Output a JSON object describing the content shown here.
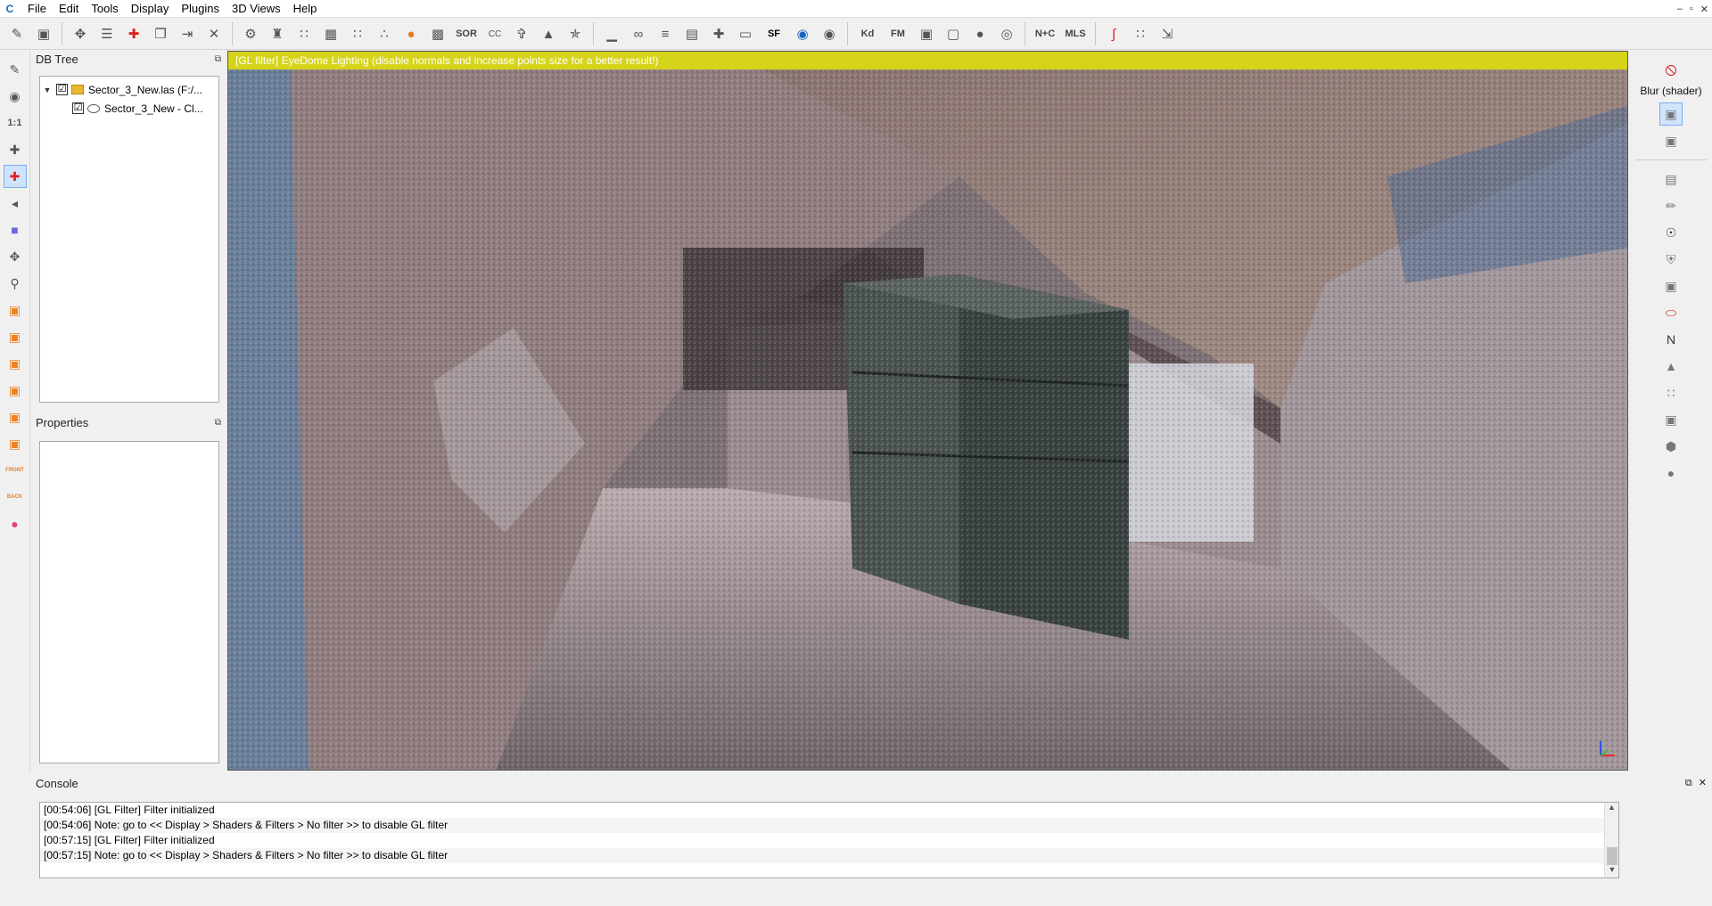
{
  "app": {
    "icon_label": "C"
  },
  "menu": [
    "File",
    "Edit",
    "Tools",
    "Display",
    "Plugins",
    "3D Views",
    "Help"
  ],
  "window_controls": [
    "–",
    "▫",
    "✕"
  ],
  "toolbar": {
    "text_buttons": {
      "sor": "SOR",
      "sf": "SF",
      "kd": "Kd",
      "fm": "FM",
      "nc": "N+C",
      "mls": "MLS",
      "cc": "CC"
    }
  },
  "db_tree": {
    "title": "DB Tree",
    "items": [
      {
        "label": "Sector_3_New.las (F:/...",
        "checked": "☑",
        "level": 0
      },
      {
        "label": "Sector_3_New - Cl...",
        "checked": "☑",
        "level": 1
      }
    ]
  },
  "properties": {
    "title": "Properties"
  },
  "view3d": {
    "banner": "[GL filter] EyeDome Lighting (disable normals and increase points size for a better result!)"
  },
  "right_panel": {
    "shader_label": "Blur (shader)",
    "n_label": "N"
  },
  "left_tools": {
    "scale_label": "1:1",
    "front_label": "FRONT",
    "back_label": "BACK"
  },
  "console": {
    "title": "Console",
    "lines": [
      "[00:54:06] [GL Filter] Filter initialized",
      "[00:54:06] Note: go to << Display > Shaders & Filters > No filter >> to disable GL filter",
      "[00:57:15] [GL Filter] Filter initialized",
      "[00:57:15] Note: go to << Display > Shaders & Filters > No filter >> to disable GL filter"
    ]
  }
}
